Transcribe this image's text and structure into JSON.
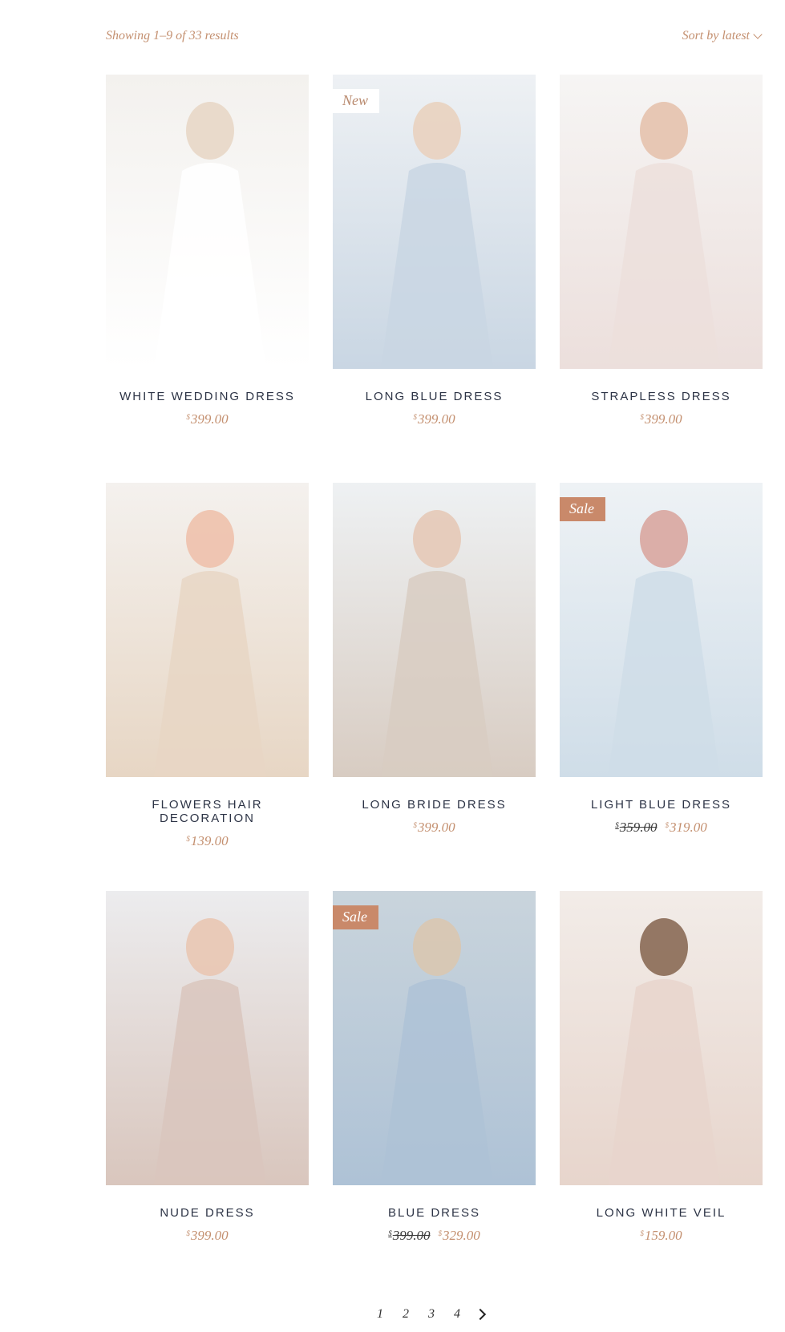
{
  "toolbar": {
    "result_count": "Showing 1–9 of 33 results",
    "sort_label": "Sort by latest"
  },
  "products": [
    {
      "title": "WHITE WEDDING DRESS",
      "currency": "$",
      "price": "399.00",
      "old_price": "",
      "badge": "",
      "palette": [
        "#f3f1ee",
        "#ffffff",
        "#e8d7c6"
      ]
    },
    {
      "title": "LONG BLUE DRESS",
      "currency": "$",
      "price": "399.00",
      "old_price": "",
      "badge": "New",
      "palette": [
        "#eef1f4",
        "#c9d6e3",
        "#e9d2bf"
      ]
    },
    {
      "title": "STRAPLESS DRESS",
      "currency": "$",
      "price": "399.00",
      "old_price": "",
      "badge": "",
      "palette": [
        "#f6f5f4",
        "#ecdfdc",
        "#e6c2ad"
      ]
    },
    {
      "title": "FLOWERS HAIR DECORATION",
      "currency": "$",
      "price": "139.00",
      "old_price": "",
      "badge": "",
      "palette": [
        "#f4f1ee",
        "#e7d6c4",
        "#eec1ac"
      ]
    },
    {
      "title": "LONG BRIDE DRESS",
      "currency": "$",
      "price": "399.00",
      "old_price": "",
      "badge": "",
      "palette": [
        "#eef1f3",
        "#d8ccc2",
        "#e6c9b7"
      ]
    },
    {
      "title": "LIGHT BLUE DRESS",
      "currency": "$",
      "price": "319.00",
      "old_price": "359.00",
      "badge": "Sale",
      "palette": [
        "#eef2f5",
        "#cfdde8",
        "#d9a6a0"
      ]
    },
    {
      "title": "NUDE DRESS",
      "currency": "$",
      "price": "399.00",
      "old_price": "",
      "badge": "",
      "palette": [
        "#ececee",
        "#d9c6bd",
        "#e9c7b2"
      ]
    },
    {
      "title": "BLUE DRESS",
      "currency": "$",
      "price": "329.00",
      "old_price": "399.00",
      "badge": "Sale",
      "palette": [
        "#c9d4dc",
        "#aec2d6",
        "#d9c7b0"
      ]
    },
    {
      "title": "LONG WHITE VEIL",
      "currency": "$",
      "price": "159.00",
      "old_price": "",
      "badge": "",
      "palette": [
        "#f2ece8",
        "#e7d5cc",
        "#8a6a55"
      ]
    }
  ],
  "pagination": {
    "pages": [
      "1",
      "2",
      "3",
      "4"
    ],
    "next_icon": "chevron-right-icon"
  },
  "colors": {
    "accent": "#c49070",
    "badge_sale": "#c9896a",
    "title_text": "#2d3446"
  }
}
